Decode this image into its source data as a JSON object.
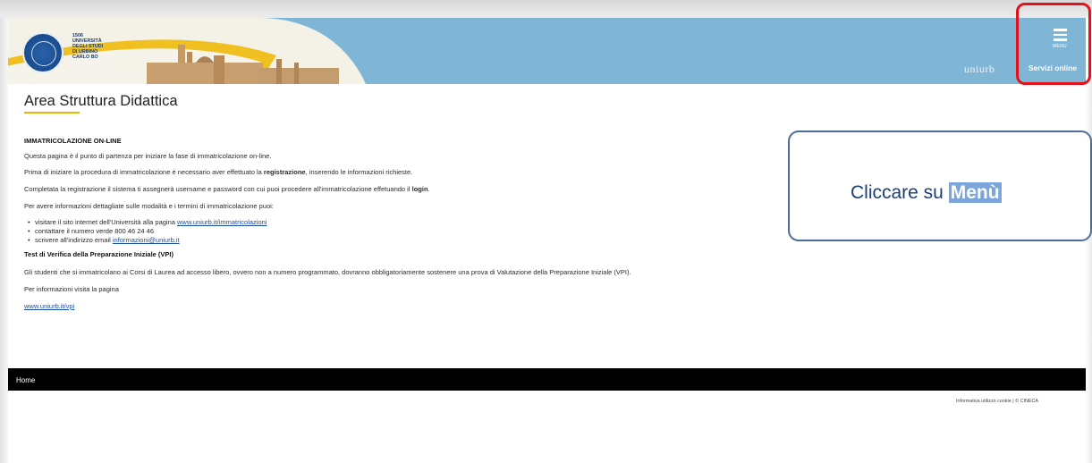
{
  "header": {
    "logo_lines": [
      "1506",
      "UNIVERSITÀ",
      "DEGLI STUDI",
      "DI URBINO",
      "CARLO BO"
    ],
    "brand_word": "uniurb",
    "menu_label": "MENU",
    "servizi_label": "Servizi online"
  },
  "page": {
    "title": "Area Struttura Didattica"
  },
  "content": {
    "heading1": "IMMATRICOLAZIONE ON-LINE",
    "p1": "Questa pagina è il punto di partenza per iniziare la fase di immatricolazione on-line.",
    "p2_a": "Prima di iniziare la procedura di immatricolazione è necessario aver effettuato la ",
    "p2_b": "registrazione",
    "p2_c": ", inserendo le informazioni richieste.",
    "p3_a": "Completata la registrazione il sistema ti assegnerà username e password con cui puoi procedere all'immatricolazione effetuando il ",
    "p3_b": "login",
    "p3_c": ".",
    "p4": "Per avere informazioni dettagliate sulle modalità e i termini di immatricolazione puoi:",
    "bullet1_a": "visitare il sito internet dell'Università alla pagina ",
    "bullet1_link": "www.uniurb.it/immatricolazioni",
    "bullet2": "contattare il numero verde 800 46 24 46",
    "bullet3_a": "scrivere all'indirizzo email ",
    "bullet3_link": "informazioni@uniurb.it",
    "heading2": "Test di Verifica della Preparazione Iniziale (VPI)",
    "p5": "Gli studenti che si immatricolano ai Corsi di Laurea ad accesso libero, ovvero non a numero programmato, dovranno obbligatoriamente sostenere una prova di Valutazione della Preparazione Iniziale (VPI).",
    "p6": "Per informazioni visita la pagina",
    "link_vpi": "www.uniurb.it/vpi"
  },
  "callout": {
    "text": "Cliccare su ",
    "highlight": "Menù"
  },
  "footer": {
    "home": "Home",
    "note": "Informativa utilizzo cookie | © CINECA"
  },
  "colors": {
    "header_bg": "#7fb6d6",
    "accent_underline": "#f0b400",
    "highlight_border": "#e3121b",
    "link": "#1a4c9c"
  }
}
